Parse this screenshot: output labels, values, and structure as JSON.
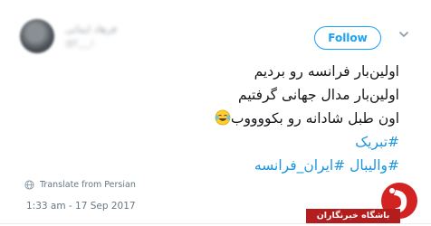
{
  "author": {
    "name": "فرهاد ایمانی",
    "handle": "@f___i"
  },
  "follow_label": "Follow",
  "tweet": {
    "lines": [
      "اولین‌بار فرانسه رو بردیم",
      "اولین‌بار مدال جهانی گرفتیم",
      "اون طبل شادانه رو بکووووب"
    ],
    "emoji": "face-with-tears-of-joy",
    "hashtag_1": "#تبریک",
    "hashtag_2": "#والیبال",
    "hashtag_3": "#ایران_فرانسه"
  },
  "translate_label": "Translate from Persian",
  "timestamp": "1:33 am - 17 Sep 2017",
  "watermark": {
    "label": "باشگاه خبرنگاران",
    "color": "#b41d1d"
  },
  "colors": {
    "link": "#1b95e0",
    "follow": "#1da1f2",
    "meta": "#657786"
  }
}
